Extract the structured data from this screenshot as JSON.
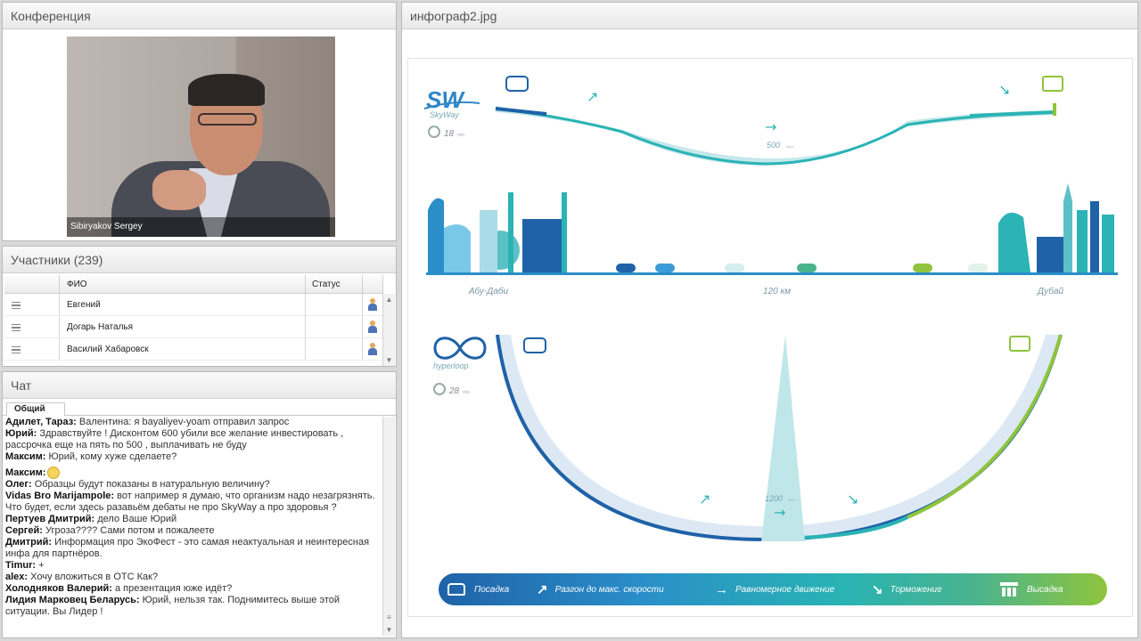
{
  "conference": {
    "title": "Конференция",
    "speaker_name": "Sibiryakov Sergey"
  },
  "participants": {
    "title": "Участники (239)",
    "columns": {
      "name": "ФИО",
      "status": "Статус"
    },
    "rows": [
      {
        "name": "Евгений"
      },
      {
        "name": "Догарь Наталья"
      },
      {
        "name": "Василий Хабаровск"
      }
    ]
  },
  "chat": {
    "title": "Чат",
    "tab": "Общий",
    "messages": [
      {
        "author": "Адилет, Тараз:",
        "text": "Валентина: я bayaliyev-yoam отправил запрос"
      },
      {
        "author": "Юрий:",
        "text": "Здравствуйте ! Дисконтом 600 убили все желание инвестировать , рассрочка еще на пять по 500 , выплачивать не буду"
      },
      {
        "author": "Максим:",
        "text": "Юрий, кому хуже сделаете?"
      },
      {
        "author": "Максим:",
        "text": "",
        "emoji": "smile"
      },
      {
        "author": "Олег:",
        "text": "Образцы будут показаны в натуральную величину?"
      },
      {
        "author": "Vidas Bro Marijampole:",
        "text": "вот например я думаю, что организм надо незагрязнять. Что будет, если здесь разавьём дебаты не про SkyWay а про здоровья ?"
      },
      {
        "author": "Пертуев Дмитрий:",
        "text": "дело Ваше Юрий"
      },
      {
        "author": "Сергей:",
        "text": "Угроза???? Сами потом и пожалеете"
      },
      {
        "author": "Дмитрий:",
        "text": "Информация про ЭкоФест - это самая неактуальная и неинтересная инфа для партнёров."
      },
      {
        "author": "Timur:",
        "text": "+"
      },
      {
        "author": "alex:",
        "text": "Хочу вложиться в ОТС Как?"
      },
      {
        "author": "Холодняков Валерий:",
        "text": "а презентация юже идёт?"
      },
      {
        "author": "Лидия  Марковец  Беларусь:",
        "text": "Юрий, нельзя так. Поднимитесь выше этой ситуации. Вы  Лидер !"
      }
    ]
  },
  "image_pod": {
    "title": "инфограф2.jpg",
    "skyway": {
      "logo": "SW",
      "logo_sub": "SkyWay",
      "time": "18",
      "time_unit": "min",
      "speed": "500",
      "speed_unit": "km/h"
    },
    "city_labels": {
      "left": "Абу-Даби",
      "middle": "120 км",
      "right": "Дубай"
    },
    "hyperloop": {
      "logo_sub": "hyperloop",
      "time": "28",
      "time_unit": "min",
      "speed": "1200",
      "speed_unit": "km/h"
    },
    "legend": [
      {
        "label": "Посадка",
        "icon": "tram-icon"
      },
      {
        "label": "Разгон до макс. скорости",
        "icon": "arrow-up-right-icon"
      },
      {
        "label": "Равномерное движение",
        "icon": "arrow-right-icon"
      },
      {
        "label": "Торможение",
        "icon": "arrow-down-right-icon"
      },
      {
        "label": "Высадка",
        "icon": "people-icon"
      }
    ],
    "colors": {
      "dark_blue": "#1f62a8",
      "teal": "#28b3b4",
      "green": "#8fc43c",
      "light_teal": "#bfe6e8"
    }
  }
}
